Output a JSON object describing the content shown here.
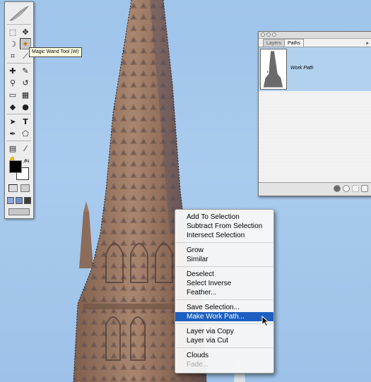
{
  "tooltip": {
    "text": "Magic Wand Tool (W)"
  },
  "toolbox": {
    "tools": [
      {
        "name": "marquee-tool",
        "glyph": "⬚"
      },
      {
        "name": "move-tool",
        "glyph": "✥"
      },
      {
        "name": "lasso-tool",
        "glyph": "☽"
      },
      {
        "name": "magic-wand-tool",
        "glyph": "✦"
      },
      {
        "name": "crop-tool",
        "glyph": "⌗"
      },
      {
        "name": "slice-tool",
        "glyph": "⟋"
      },
      {
        "name": "healing-brush-tool",
        "glyph": "✚"
      },
      {
        "name": "brush-tool",
        "glyph": "✎"
      },
      {
        "name": "clone-stamp-tool",
        "glyph": "⚲"
      },
      {
        "name": "history-brush-tool",
        "glyph": "↺"
      },
      {
        "name": "eraser-tool",
        "glyph": "▭"
      },
      {
        "name": "gradient-tool",
        "glyph": "▦"
      },
      {
        "name": "blur-tool",
        "glyph": "◆"
      },
      {
        "name": "dodge-tool",
        "glyph": "●"
      },
      {
        "name": "path-selection-tool",
        "glyph": "➤"
      },
      {
        "name": "type-tool",
        "glyph": "T"
      },
      {
        "name": "pen-tool",
        "glyph": "✒"
      },
      {
        "name": "shape-tool",
        "glyph": "⬠"
      },
      {
        "name": "notes-tool",
        "glyph": "▤"
      },
      {
        "name": "eyedropper-tool",
        "glyph": "⁄"
      },
      {
        "name": "hand-tool",
        "glyph": "✋"
      },
      {
        "name": "zoom-tool",
        "glyph": "⌕"
      }
    ]
  },
  "palette": {
    "tabs": [
      {
        "label": "Layers"
      },
      {
        "label": "Paths"
      }
    ],
    "path_name": "Work Path"
  },
  "context_menu": {
    "groups": [
      [
        "Add To Selection",
        "Subtract From Selection",
        "Intersect Selection"
      ],
      [
        "Grow",
        "Similar"
      ],
      [
        "Deselect",
        "Select Inverse",
        "Feather..."
      ],
      [
        "Save Selection...",
        "Make Work Path..."
      ],
      [
        "Layer via Copy",
        "Layer via Cut"
      ],
      [
        "Clouds",
        "Fade..."
      ]
    ],
    "highlighted": "Make Work Path...",
    "disabled": [
      "Fade..."
    ]
  },
  "colors": {
    "menu_highlight": "#1c5fbf",
    "sky": "#a9cbee",
    "stone": "#8a6a57"
  }
}
